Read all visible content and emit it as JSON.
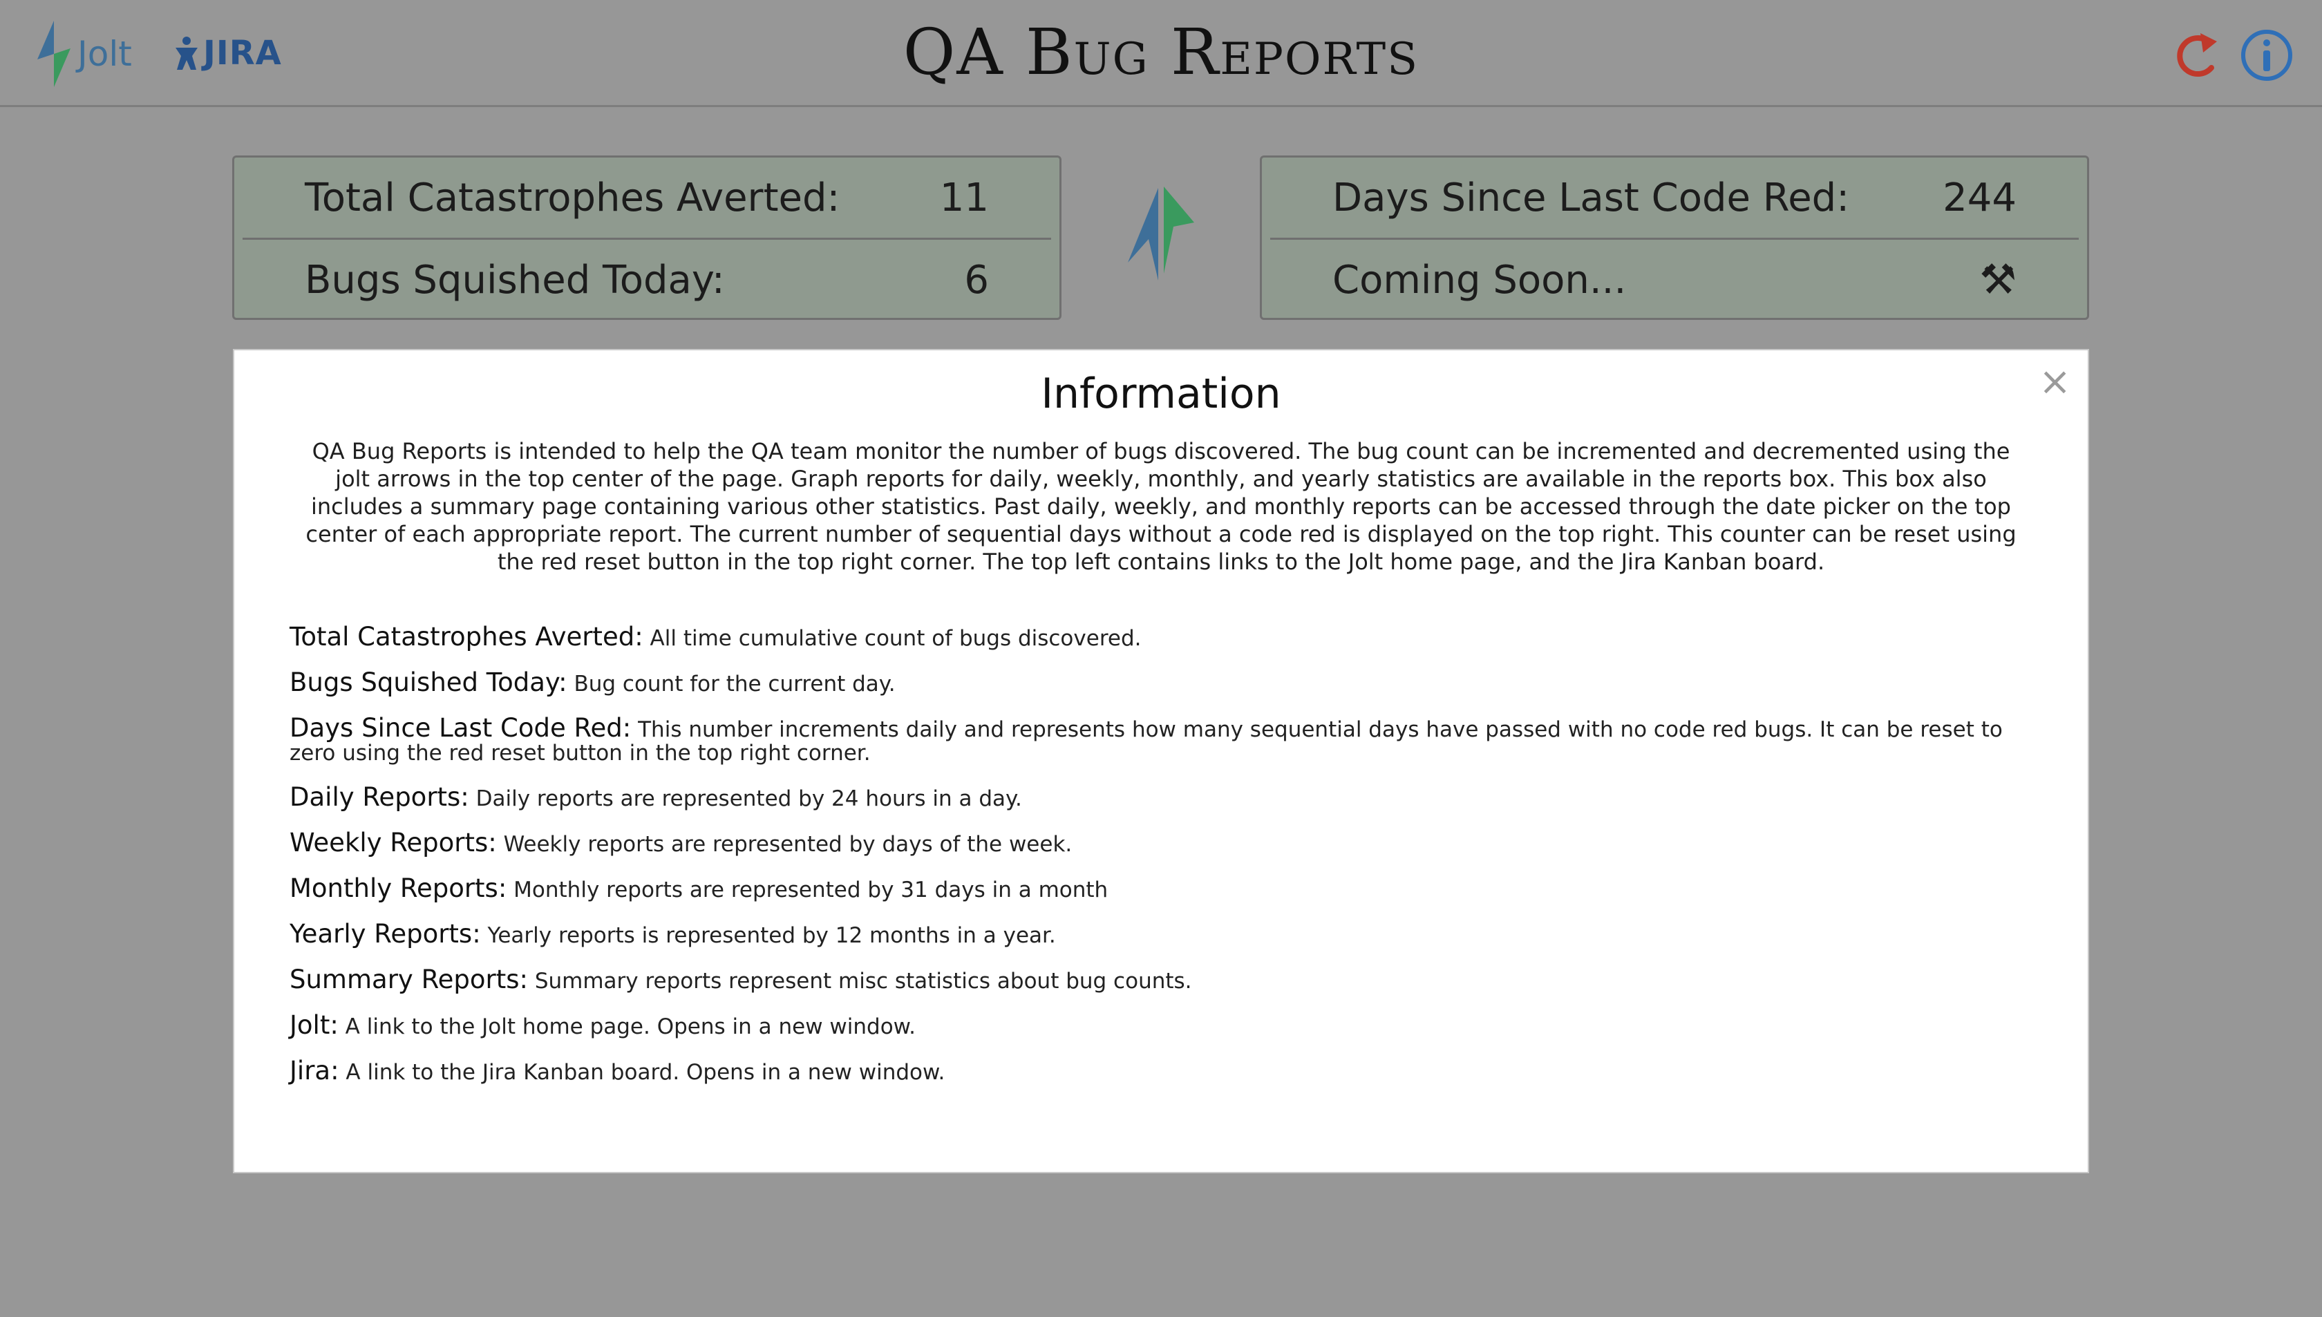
{
  "header": {
    "title": "QA Bug Reports",
    "jolt_label": "Jolt",
    "jira_label": "JIRA",
    "reset_icon": "reset-arrow-icon",
    "info_icon": "info-circle-icon",
    "colors": {
      "reset": "#c0392b",
      "info": "#2f6fb7",
      "jolt_blue": "#3e6f99",
      "jolt_green": "#3a9a5e"
    }
  },
  "stats_left": [
    {
      "label": "Total Catastrophes Averted:",
      "value": "11"
    },
    {
      "label": "Bugs Squished Today:",
      "value": "6"
    }
  ],
  "stats_right": [
    {
      "label": "Days Since Last Code Red:",
      "value": "244"
    },
    {
      "label": "Coming Soon...",
      "icon": "tools-icon",
      "glyph": "⚒"
    }
  ],
  "modal": {
    "title": "Information",
    "close": "×",
    "intro": "QA Bug Reports is intended to help the QA team monitor the number of bugs discovered. The bug count can be incremented and decremented using the jolt arrows in the top center of the page. Graph reports for daily, weekly, monthly, and yearly statistics are available in the reports box. This box also includes a summary page containing various other statistics. Past daily, weekly, and monthly reports can be accessed through the date picker on the top center of each appropriate report. The current number of sequential days without a code red is displayed on the top right. This counter can be reset using the red reset button in the top right corner. The top left contains links to the Jolt home page, and the Jira Kanban board.",
    "definitions": [
      {
        "term": "Total Catastrophes Averted:",
        "desc": "All time cumulative count of bugs discovered."
      },
      {
        "term": "Bugs Squished Today:",
        "desc": "Bug count for the current day."
      },
      {
        "term": "Days Since Last Code Red:",
        "desc": "This number increments daily and represents how many sequential days have passed with no code red bugs. It can be reset to zero using the red reset button in the top right corner."
      },
      {
        "term": "Daily Reports:",
        "desc": "Daily reports are represented by 24 hours in a day."
      },
      {
        "term": "Weekly Reports:",
        "desc": "Weekly reports are represented by days of the week."
      },
      {
        "term": "Monthly Reports:",
        "desc": "Monthly reports are represented by 31 days in a month"
      },
      {
        "term": "Yearly Reports:",
        "desc": "Yearly reports is represented by 12 months in a year."
      },
      {
        "term": "Summary Reports:",
        "desc": "Summary reports represent misc statistics about bug counts."
      },
      {
        "term": "Jolt:",
        "desc": "A link to the Jolt home page. Opens in a new window."
      },
      {
        "term": "Jira:",
        "desc": "A link to the Jira Kanban board. Opens in a new window."
      }
    ]
  }
}
